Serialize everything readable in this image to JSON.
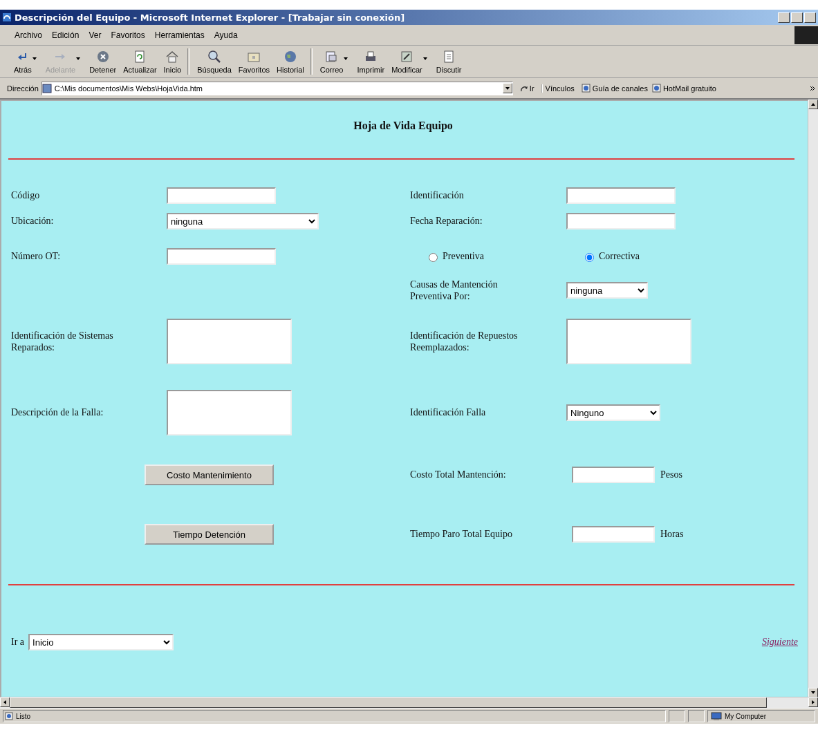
{
  "window": {
    "title": "Descripción del Equipo - Microsoft Internet Explorer - [Trabajar sin conexión]"
  },
  "menu": [
    "Archivo",
    "Edición",
    "Ver",
    "Favoritos",
    "Herramientas",
    "Ayuda"
  ],
  "toolbar": [
    [
      {
        "label": "Atrás",
        "disabled": false,
        "dropdown": true
      },
      {
        "label": "Adelante",
        "disabled": true,
        "dropdown": true
      },
      {
        "label": "Detener",
        "disabled": false,
        "dropdown": false
      },
      {
        "label": "Actualizar",
        "disabled": false,
        "dropdown": false
      },
      {
        "label": "Inicio",
        "disabled": false,
        "dropdown": false
      }
    ],
    [
      {
        "label": "Búsqueda",
        "disabled": false,
        "dropdown": false
      },
      {
        "label": "Favoritos",
        "disabled": false,
        "dropdown": false
      },
      {
        "label": "Historial",
        "disabled": false,
        "dropdown": false
      }
    ],
    [
      {
        "label": "Correo",
        "disabled": false,
        "dropdown": true
      },
      {
        "label": "Imprimir",
        "disabled": false,
        "dropdown": false
      },
      {
        "label": "Modificar",
        "disabled": false,
        "dropdown": true
      },
      {
        "label": "Discutir",
        "disabled": false,
        "dropdown": false
      }
    ]
  ],
  "address": {
    "label": "Dirección",
    "value": "C:\\Mis documentos\\Mis Webs\\HojaVida.htm",
    "go": "Ir"
  },
  "links": {
    "label": "Vínculos",
    "items": [
      "Guía de canales",
      "HotMail gratuito"
    ]
  },
  "page": {
    "heading": "Hoja de Vida Equipo",
    "rows": [
      {
        "left": {
          "kind": "text",
          "label": "Código"
        },
        "right": {
          "kind": "text",
          "label": "Identificación"
        }
      },
      {
        "left": {
          "kind": "select",
          "label": "Ubicación:",
          "value": "ninguna"
        },
        "right": {
          "kind": "text",
          "label": "Fecha Reparación:"
        }
      },
      {
        "left": {
          "kind": "text",
          "label": "Número OT:"
        },
        "right": {
          "kind": "radio",
          "options": [
            {
              "label": "Preventiva",
              "selected": false
            },
            {
              "label": "Correctiva",
              "selected": true
            }
          ]
        }
      },
      {
        "left": {
          "kind": "empty"
        },
        "right": {
          "kind": "select",
          "label": "Causas de Mantención Preventiva Por:",
          "value": "ninguna"
        }
      },
      {
        "left": {
          "kind": "textarea",
          "label": " Identificación de Sistemas Reparados:"
        },
        "right": {
          "kind": "textarea",
          "label": "Identificación de Repuestos Reemplazados:"
        }
      },
      {
        "left": {
          "kind": "textarea",
          "label": "Descripción de la Falla:"
        },
        "right": {
          "kind": "select",
          "label": "Identificación Falla",
          "value": "Ninguno"
        }
      },
      {
        "left": {
          "kind": "button",
          "label": "Costo Mantenimiento"
        },
        "right": {
          "kind": "total",
          "label": "Costo Total Mantención:",
          "unit": "Pesos"
        }
      },
      {
        "left": {
          "kind": "button",
          "label": "Tiempo Detención"
        },
        "right": {
          "kind": "total",
          "label": "Tiempo Paro Total Equipo",
          "unit": "Horas"
        }
      }
    ],
    "goto": {
      "label": "Ir a",
      "value": "Inicio"
    },
    "next": "Siguiente"
  },
  "status": {
    "text": "Listo",
    "zone": "My Computer"
  }
}
